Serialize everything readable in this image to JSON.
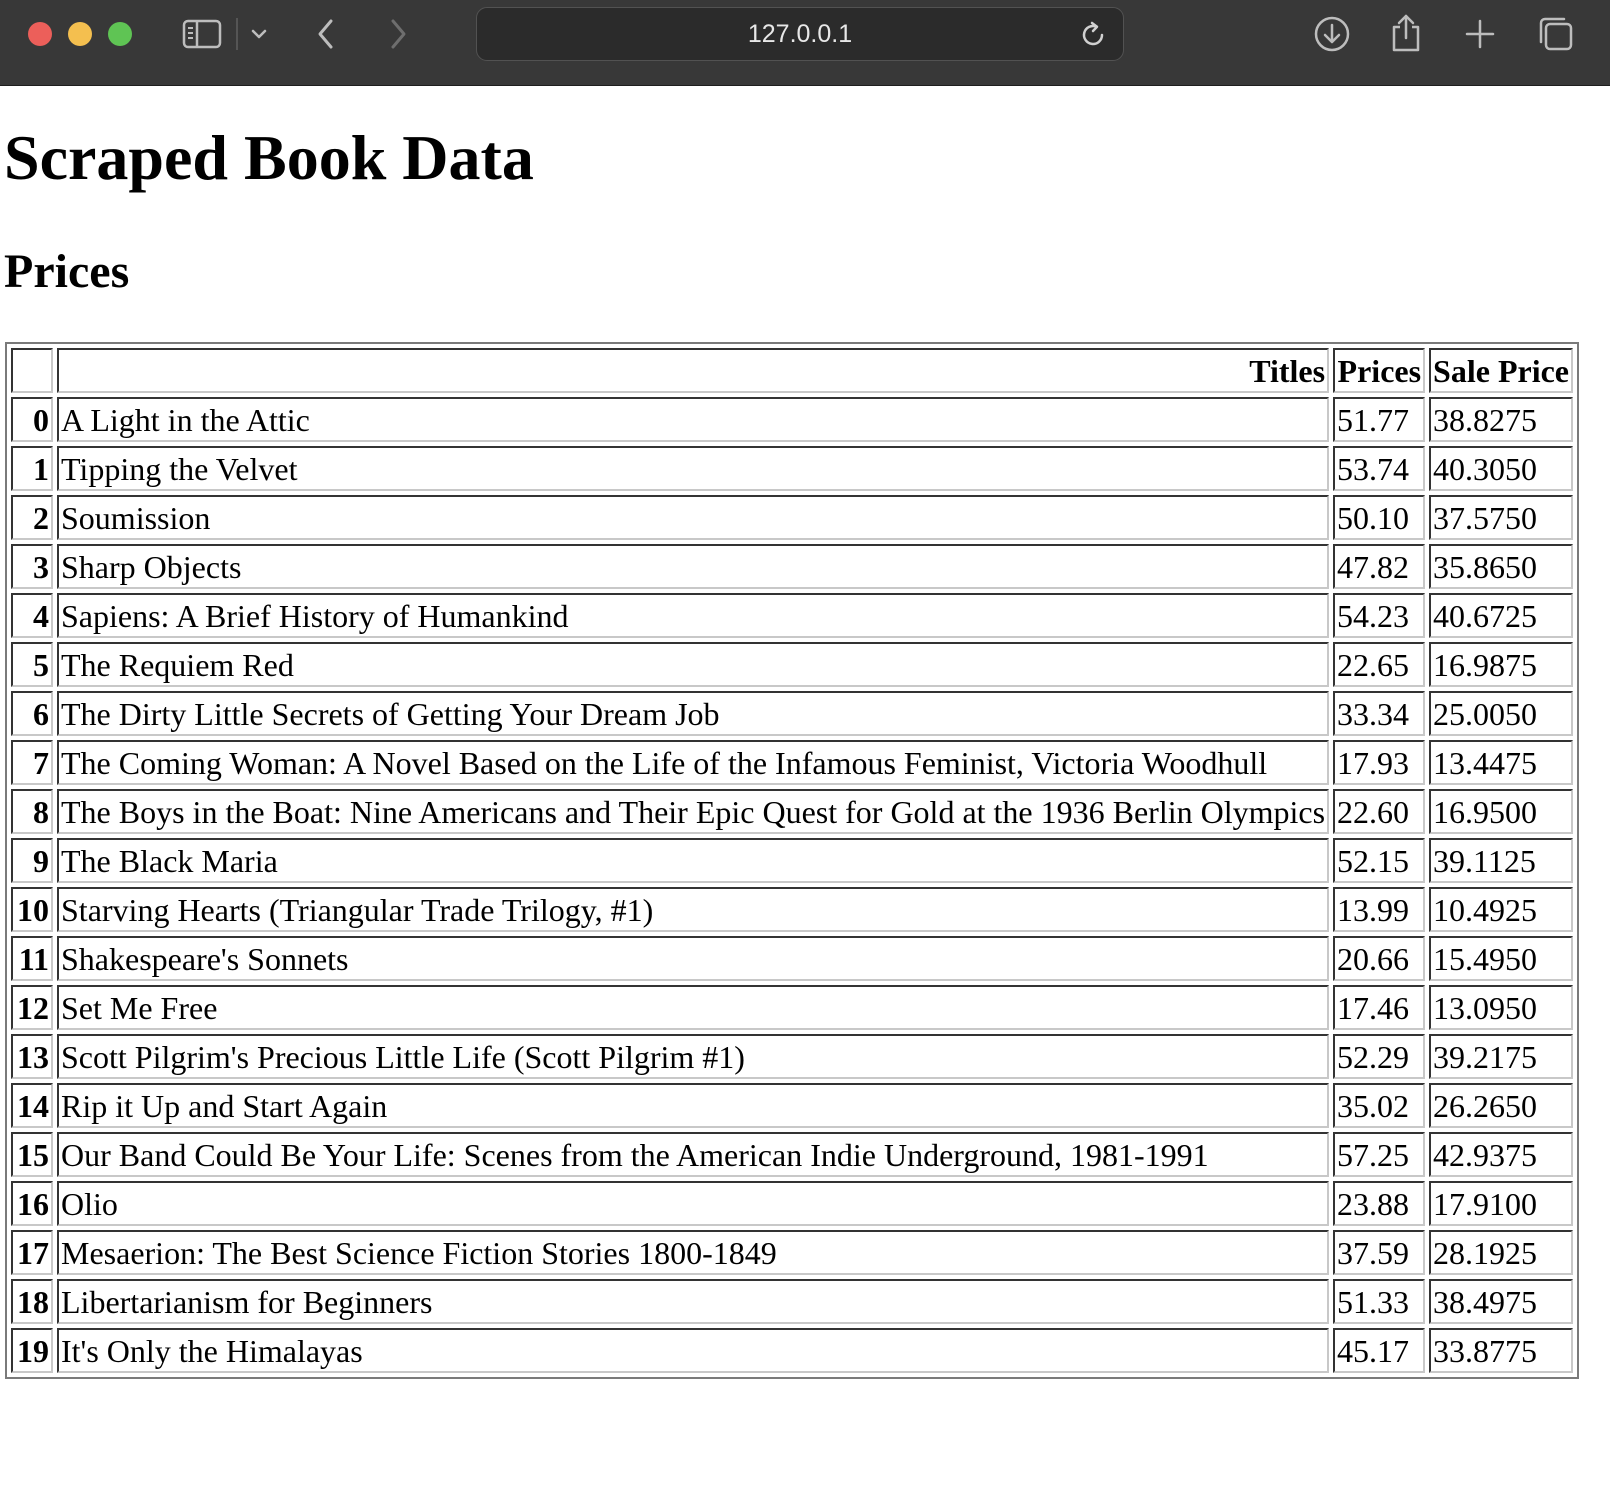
{
  "browser": {
    "address": "127.0.0.1"
  },
  "page": {
    "title": "Scraped Book Data",
    "subtitle": "Prices"
  },
  "table": {
    "columns": [
      "",
      "Titles",
      "Prices",
      "Sale Price"
    ],
    "rows": [
      {
        "index": "0",
        "title": "A Light in the Attic",
        "price": "51.77",
        "sale": "38.8275"
      },
      {
        "index": "1",
        "title": "Tipping the Velvet",
        "price": "53.74",
        "sale": "40.3050"
      },
      {
        "index": "2",
        "title": "Soumission",
        "price": "50.10",
        "sale": "37.5750"
      },
      {
        "index": "3",
        "title": "Sharp Objects",
        "price": "47.82",
        "sale": "35.8650"
      },
      {
        "index": "4",
        "title": "Sapiens: A Brief History of Humankind",
        "price": "54.23",
        "sale": "40.6725"
      },
      {
        "index": "5",
        "title": "The Requiem Red",
        "price": "22.65",
        "sale": "16.9875"
      },
      {
        "index": "6",
        "title": "The Dirty Little Secrets of Getting Your Dream Job",
        "price": "33.34",
        "sale": "25.0050"
      },
      {
        "index": "7",
        "title": "The Coming Woman: A Novel Based on the Life of the Infamous Feminist, Victoria Woodhull",
        "price": "17.93",
        "sale": "13.4475"
      },
      {
        "index": "8",
        "title": "The Boys in the Boat: Nine Americans and Their Epic Quest for Gold at the 1936 Berlin Olympics",
        "price": "22.60",
        "sale": "16.9500"
      },
      {
        "index": "9",
        "title": "The Black Maria",
        "price": "52.15",
        "sale": "39.1125"
      },
      {
        "index": "10",
        "title": "Starving Hearts (Triangular Trade Trilogy, #1)",
        "price": "13.99",
        "sale": "10.4925"
      },
      {
        "index": "11",
        "title": "Shakespeare's Sonnets",
        "price": "20.66",
        "sale": "15.4950"
      },
      {
        "index": "12",
        "title": "Set Me Free",
        "price": "17.46",
        "sale": "13.0950"
      },
      {
        "index": "13",
        "title": "Scott Pilgrim's Precious Little Life (Scott Pilgrim #1)",
        "price": "52.29",
        "sale": "39.2175"
      },
      {
        "index": "14",
        "title": "Rip it Up and Start Again",
        "price": "35.02",
        "sale": "26.2650"
      },
      {
        "index": "15",
        "title": "Our Band Could Be Your Life: Scenes from the American Indie Underground, 1981-1991",
        "price": "57.25",
        "sale": "42.9375"
      },
      {
        "index": "16",
        "title": "Olio",
        "price": "23.88",
        "sale": "17.9100"
      },
      {
        "index": "17",
        "title": "Mesaerion: The Best Science Fiction Stories 1800-1849",
        "price": "37.59",
        "sale": "28.1925"
      },
      {
        "index": "18",
        "title": "Libertarianism for Beginners",
        "price": "51.33",
        "sale": "38.4975"
      },
      {
        "index": "19",
        "title": "It's Only the Himalayas",
        "price": "45.17",
        "sale": "33.8775"
      }
    ]
  },
  "icons": {
    "sidebar": "sidebar-icon",
    "chevron": "chevron-down-icon",
    "back": "back-arrow-icon",
    "forward": "forward-arrow-icon",
    "reload": "reload-icon",
    "download": "download-icon",
    "share": "share-icon",
    "new_tab": "plus-icon",
    "tabs": "tab-overview-icon"
  }
}
